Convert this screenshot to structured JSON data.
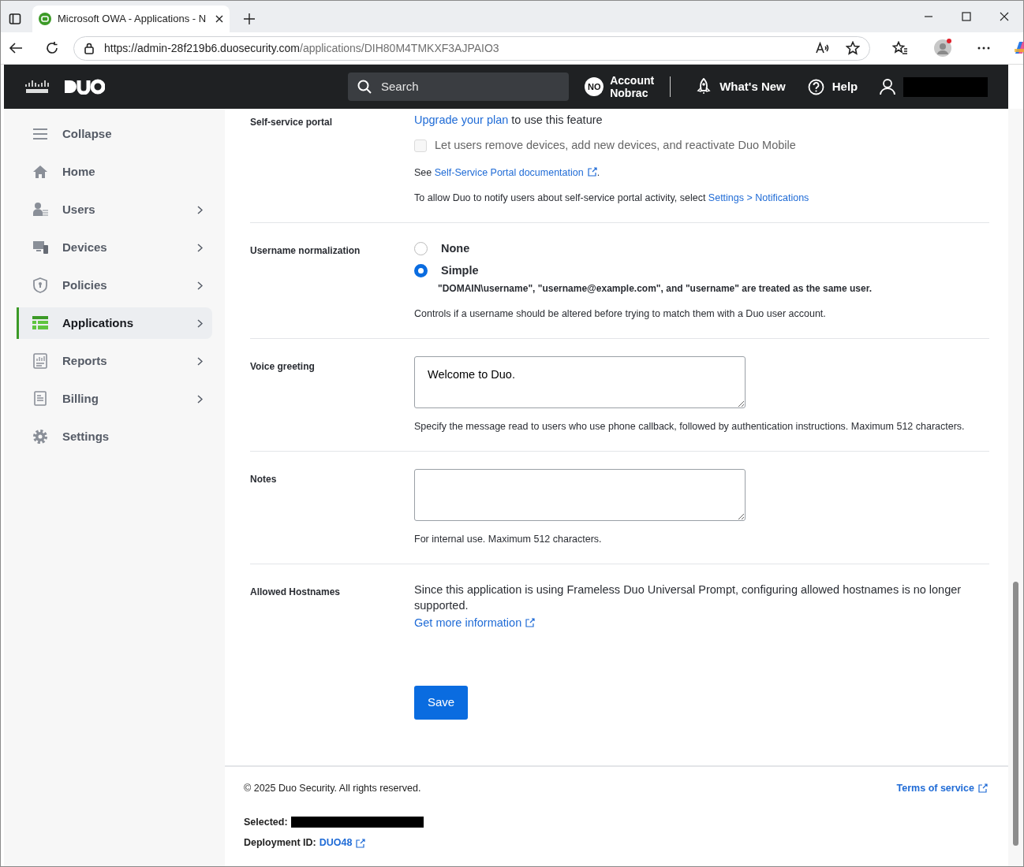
{
  "browser": {
    "tab_title": "Microsoft OWA - Applications - N",
    "url_host": "https://admin-28f219b6.duosecurity.com",
    "url_path": "/applications/DIH80M4TMKXF3AJPAIO3"
  },
  "header": {
    "search_placeholder": "Search",
    "account_initials": "NO",
    "account_label": "Account",
    "account_name": "Nobrac",
    "whats_new": "What's New",
    "help": "Help"
  },
  "sidebar": {
    "items": [
      {
        "label": "Collapse",
        "has_submenu": false,
        "selected": false
      },
      {
        "label": "Home",
        "has_submenu": false,
        "selected": false
      },
      {
        "label": "Users",
        "has_submenu": true,
        "selected": false
      },
      {
        "label": "Devices",
        "has_submenu": true,
        "selected": false
      },
      {
        "label": "Policies",
        "has_submenu": true,
        "selected": false
      },
      {
        "label": "Applications",
        "has_submenu": true,
        "selected": true
      },
      {
        "label": "Reports",
        "has_submenu": true,
        "selected": false
      },
      {
        "label": "Billing",
        "has_submenu": true,
        "selected": false
      },
      {
        "label": "Settings",
        "has_submenu": false,
        "selected": false
      }
    ]
  },
  "sections": [
    {
      "label": "Self-service portal",
      "blocks": [
        {
          "kind": "lead",
          "parts": [
            {
              "text": "Upgrade your plan",
              "kind": "link"
            },
            {
              "text": " to use this feature",
              "kind": "text"
            }
          ]
        },
        {
          "kind": "checkbox",
          "label": "Let users remove devices, add new devices, and reactivate Duo Mobile",
          "checked": false,
          "disabled": true
        },
        {
          "kind": "paragraph",
          "parts": [
            {
              "text": "See ",
              "kind": "text"
            },
            {
              "text": "Self-Service Portal documentation",
              "kind": "external_link"
            },
            {
              "text": ".",
              "kind": "text"
            }
          ]
        },
        {
          "kind": "paragraph",
          "parts": [
            {
              "text": "To allow Duo to notify users about self-service portal activity, select ",
              "kind": "text"
            },
            {
              "text": "Settings > Notifications",
              "kind": "link"
            }
          ]
        }
      ]
    },
    {
      "label": "Username normalization",
      "blocks": [
        {
          "kind": "radios",
          "options": [
            {
              "label": "None",
              "selected": false
            },
            {
              "label": "Simple",
              "selected": true,
              "description": "\"DOMAIN\\username\", \"username@example.com\", and \"username\" are treated as the same user."
            }
          ]
        },
        {
          "kind": "paragraph",
          "parts": [
            {
              "text": "Controls if a username should be altered before trying to match them with a Duo user account.",
              "kind": "text"
            }
          ]
        }
      ]
    },
    {
      "label": "Voice greeting",
      "blocks": [
        {
          "kind": "textarea",
          "value": "Welcome to Duo."
        },
        {
          "kind": "paragraph",
          "parts": [
            {
              "text": "Specify the message read to users who use phone callback, followed by authentication instructions. Maximum 512 characters.",
              "kind": "text"
            }
          ]
        }
      ]
    },
    {
      "label": "Notes",
      "blocks": [
        {
          "kind": "textarea"
        },
        {
          "kind": "paragraph",
          "parts": [
            {
              "text": "For internal use. Maximum 512 characters.",
              "kind": "text"
            }
          ]
        }
      ]
    },
    {
      "label": "Allowed Hostnames",
      "blocks": [
        {
          "kind": "lead",
          "parts": [
            {
              "text": "Since this application is using Frameless Duo Universal Prompt, configuring allowed hostnames is no longer supported.",
              "kind": "text"
            }
          ]
        },
        {
          "kind": "lead",
          "parts": [
            {
              "text": "Get more information",
              "kind": "external_link"
            }
          ]
        }
      ]
    }
  ],
  "save_button": "Save",
  "footer": {
    "copyright": "© 2025 Duo Security. All rights reserved.",
    "terms": "Terms of service",
    "selected_label": "Selected:",
    "deployment_label": "Deployment ID:",
    "deployment_id": "DUO48"
  }
}
